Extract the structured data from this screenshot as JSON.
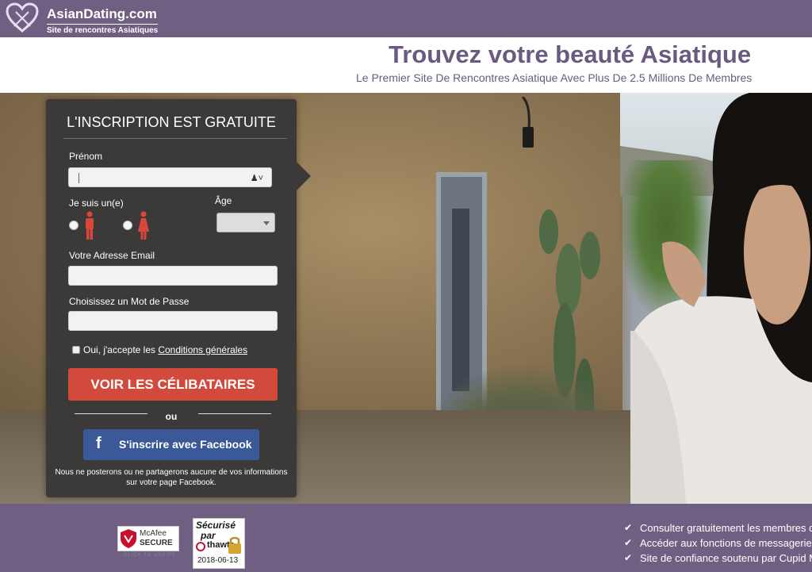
{
  "brand": {
    "name": "AsianDating.com",
    "tagline": "Site de rencontres Asiatiques"
  },
  "header": {
    "headline": "Trouvez votre beauté Asiatique",
    "subline": "Le Premier Site De Rencontres Asiatique Avec Plus De 2.5 Millions De Membres"
  },
  "form": {
    "title": "L'INSCRIPTION EST GRATUITE",
    "firstname_label": "Prénom",
    "firstname_value": "",
    "gender_label": "Je suis un(e)",
    "age_label": "Âge",
    "email_label": "Votre Adresse Email",
    "email_value": "",
    "password_label": "Choisissez un Mot de Passe",
    "password_value": "",
    "terms_prefix": "Oui, j'accepte les ",
    "terms_link": "Conditions générales",
    "submit_label": "VOIR LES CÉLIBATAIRES",
    "or_label": "ou",
    "facebook_label": "S'inscrire avec Facebook",
    "facebook_note": "Nous ne posterons ou ne partagerons aucune de vos informations sur votre page Facebook."
  },
  "footer": {
    "mcafee_line1": "McAfee",
    "mcafee_line2": "SECURE",
    "mcafee_line3": "CLICK TO VERIFY",
    "thawte_line1": "Sécurisé",
    "thawte_line2": "par",
    "thawte_brand": "thawte",
    "thawte_date": "2018-06-13",
    "features": [
      "Consulter gratuitement les membres d",
      "Accéder aux fonctions de messagerie",
      "Site de confiance soutenu par Cupid M"
    ]
  },
  "colors": {
    "brand_purple": "#6f5f82",
    "cta_red": "#d24a3c",
    "facebook_blue": "#3b5998",
    "panel_dark": "#3c3a39"
  }
}
